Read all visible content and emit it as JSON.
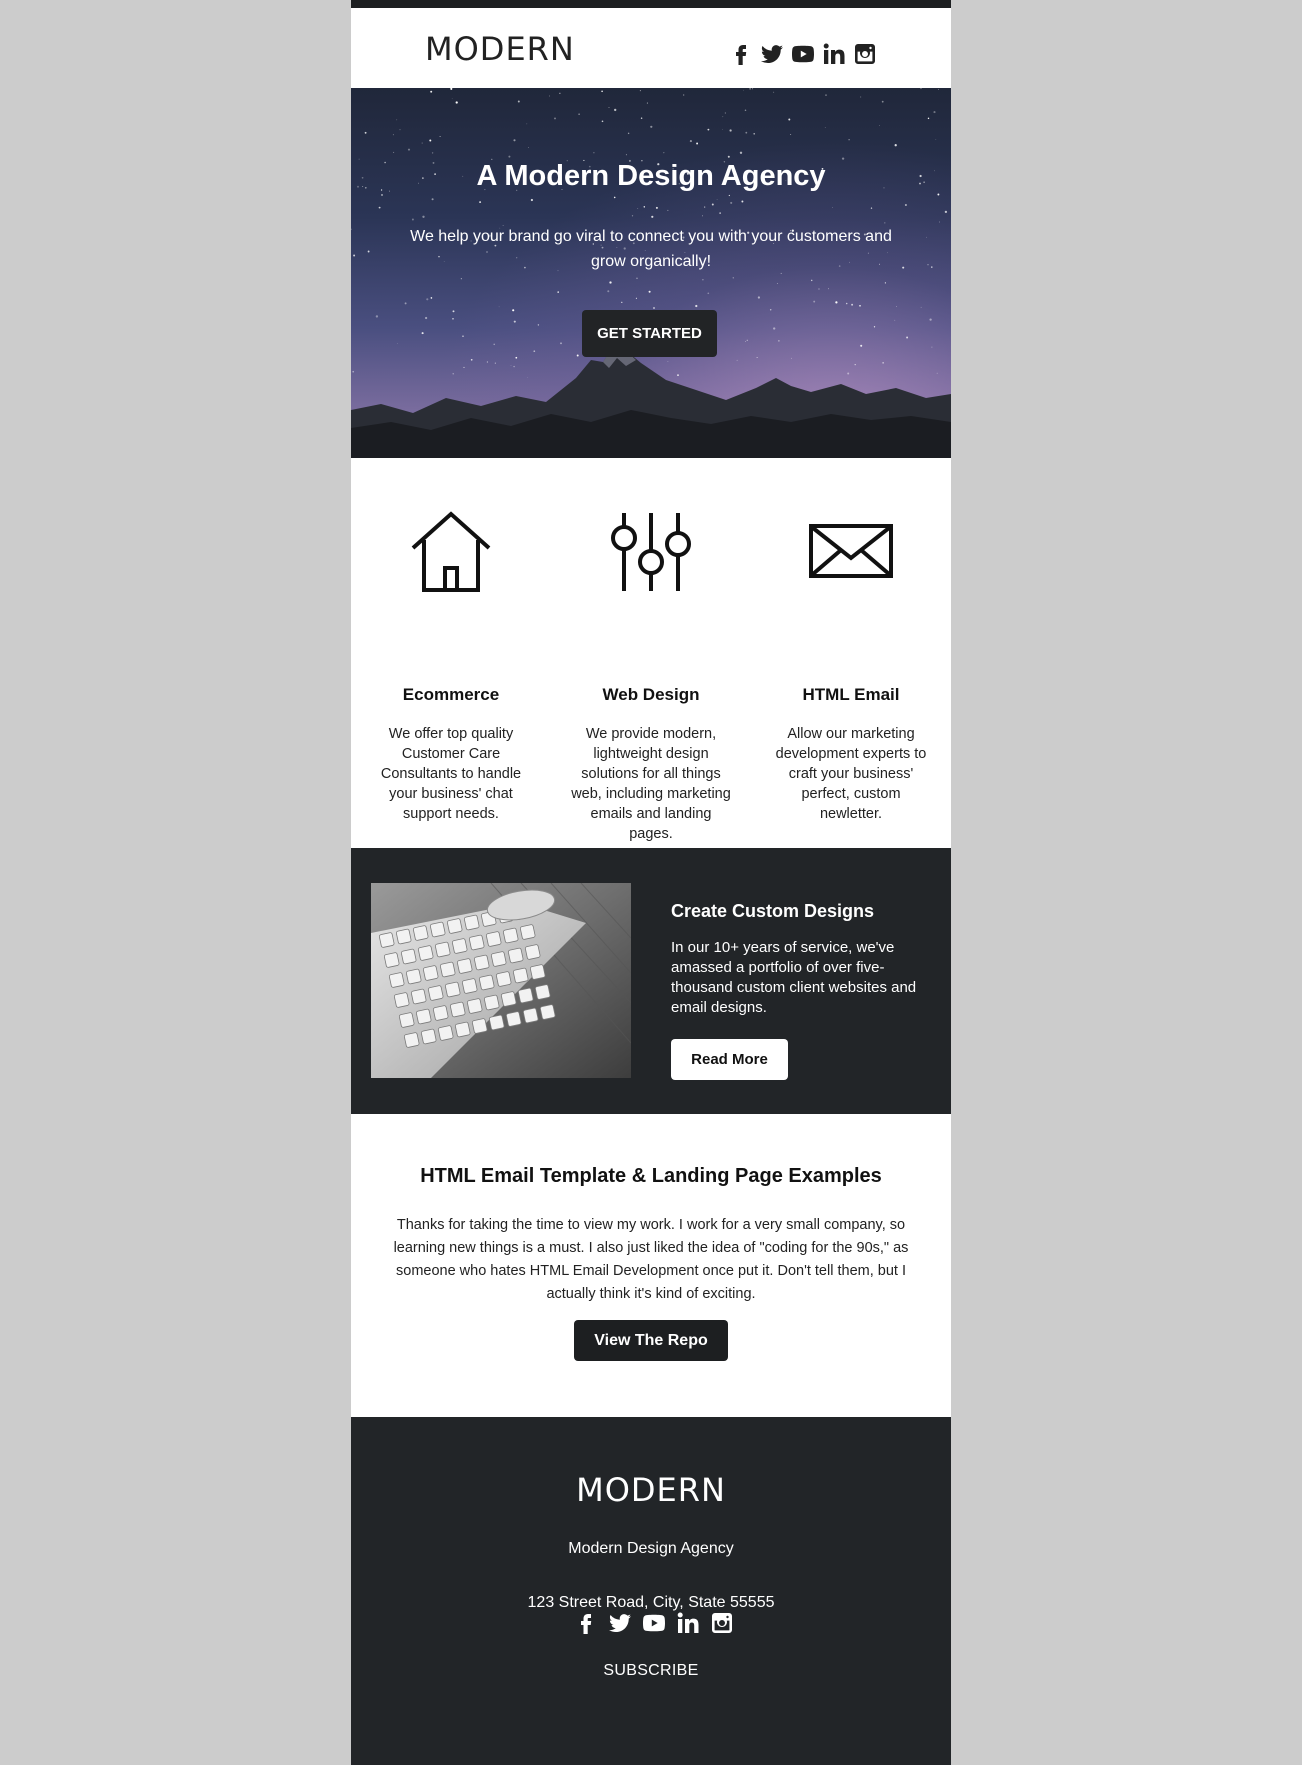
{
  "colors": {
    "page_background": "#cccccc",
    "dark": "#222528",
    "button_dark": "#1d1f21",
    "white": "#ffffff"
  },
  "header": {
    "logo": "MODERN",
    "social_icons": [
      "facebook-icon",
      "twitter-icon",
      "youtube-icon",
      "linkedin-icon",
      "instagram-icon"
    ]
  },
  "hero": {
    "title": "A Modern Design Agency",
    "text": "We help your brand go viral to connect you with your customers and grow organically!",
    "button_label": "GET STARTED"
  },
  "features": [
    {
      "icon": "house-icon",
      "title": "Ecommerce",
      "text": "We offer top quality Customer Care Consultants to handle your business' chat support needs."
    },
    {
      "icon": "sliders-icon",
      "title": "Web Design",
      "text": "We provide modern, lightweight design solutions for all things web, including marketing emails and landing pages."
    },
    {
      "icon": "envelope-icon",
      "title": "HTML Email",
      "text": "Allow our marketing development experts to craft your business' perfect, custom newletter."
    }
  ],
  "promo": {
    "image": "keyboard-and-mouse-photo",
    "title": "Create Custom Designs",
    "text": "In our 10+ years of service, we've amassed a portfolio of over five-thousand custom client websites and email designs.",
    "button_label": "Read More"
  },
  "examples": {
    "title": "HTML Email Template & Landing Page Examples",
    "text": "Thanks for taking the time to view my work. I work for a very small company, so learning new things is a must. I also just liked the idea of \"coding for the 90s,\" as someone who hates HTML Email Development once put it. Don't tell them, but I actually think it's kind of exciting.",
    "button_label": "View The Repo"
  },
  "footer": {
    "logo": "MODERN",
    "company": "Modern Design Agency",
    "address": "123 Street Road, City, State 55555",
    "social_icons": [
      "facebook-icon",
      "twitter-icon",
      "youtube-icon",
      "linkedin-icon",
      "instagram-icon"
    ],
    "subscribe_label": "SUBSCRIBE"
  }
}
